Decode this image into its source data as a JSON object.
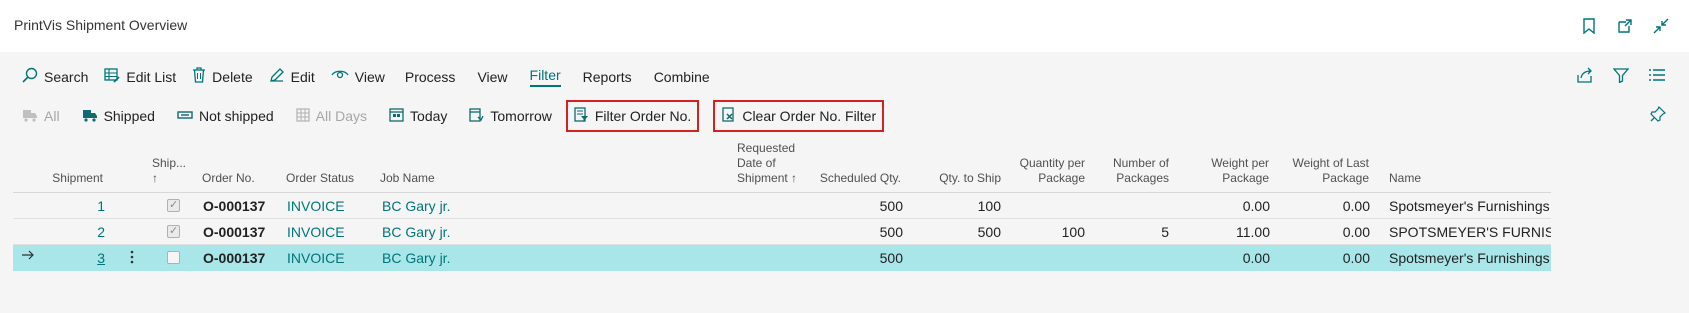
{
  "page": {
    "title": "PrintVis Shipment Overview"
  },
  "header_icons": [
    "bookmark-icon",
    "open-new-window-icon",
    "collapse-icon"
  ],
  "actions": [
    {
      "label": "Search",
      "icon": "search-icon"
    },
    {
      "label": "Edit List",
      "icon": "edit-list-icon"
    },
    {
      "label": "Delete",
      "icon": "trash-icon"
    },
    {
      "label": "Edit",
      "icon": "pencil-icon"
    },
    {
      "label": "View",
      "icon": "eye-icon"
    },
    {
      "label": "Process"
    },
    {
      "label": "View"
    },
    {
      "label": "Filter",
      "active": true
    },
    {
      "label": "Reports"
    },
    {
      "label": "Combine"
    }
  ],
  "right_actions": [
    "share-icon",
    "filter-icon",
    "list-view-icon"
  ],
  "filter_actions": {
    "all": "All",
    "shipped": "Shipped",
    "not_shipped": "Not shipped",
    "all_days": "All Days",
    "today": "Today",
    "tomorrow": "Tomorrow",
    "filter_order": "Filter Order No.",
    "clear_filter": "Clear Order No. Filter"
  },
  "columns": {
    "shipment": "Shipment",
    "shipped_1": "Ship...",
    "shipped_2": "↑",
    "order_no": "Order No.",
    "order_status": "Order Status",
    "job_name": "Job Name",
    "req_date_1": "Requested",
    "req_date_2": "Date of",
    "req_date_3": "Shipment ↑",
    "scheduled_qty": "Scheduled Qty.",
    "qty_to_ship": "Qty. to Ship",
    "qty_per_pkg_1": "Quantity per",
    "qty_per_pkg_2": "Package",
    "num_pkgs_1": "Number of",
    "num_pkgs_2": "Packages",
    "weight_per_pkg_1": "Weight per",
    "weight_per_pkg_2": "Package",
    "weight_last_1": "Weight of Last",
    "weight_last_2": "Package",
    "name": "Name"
  },
  "rows": [
    {
      "shipment": "1",
      "shipped": true,
      "order_no": "O-000137",
      "status": "INVOICE",
      "job_name": "BC Gary jr.",
      "scheduled_qty": "500",
      "qty_to_ship": "100",
      "qty_per_pkg": "",
      "num_pkgs": "",
      "weight_per_pkg": "0.00",
      "weight_last": "0.00",
      "name": "Spotsmeyer's Furnishings"
    },
    {
      "shipment": "2",
      "shipped": true,
      "order_no": "O-000137",
      "status": "INVOICE",
      "job_name": "BC Gary jr.",
      "scheduled_qty": "500",
      "qty_to_ship": "500",
      "qty_per_pkg": "100",
      "num_pkgs": "5",
      "weight_per_pkg": "11.00",
      "weight_last": "0.00",
      "name": "SPOTSMEYER'S FURNISHING"
    },
    {
      "shipment": "3",
      "shipped": false,
      "order_no": "O-000137",
      "status": "INVOICE",
      "job_name": "BC Gary jr.",
      "scheduled_qty": "500",
      "qty_to_ship": "",
      "qty_per_pkg": "",
      "num_pkgs": "",
      "weight_per_pkg": "0.00",
      "weight_last": "0.00",
      "name": "Spotsmeyer's Furnishings",
      "selected": true
    }
  ],
  "colors": {
    "accent": "#00757a",
    "highlight_box": "#d42222",
    "selected_row": "#a8e6ea"
  }
}
